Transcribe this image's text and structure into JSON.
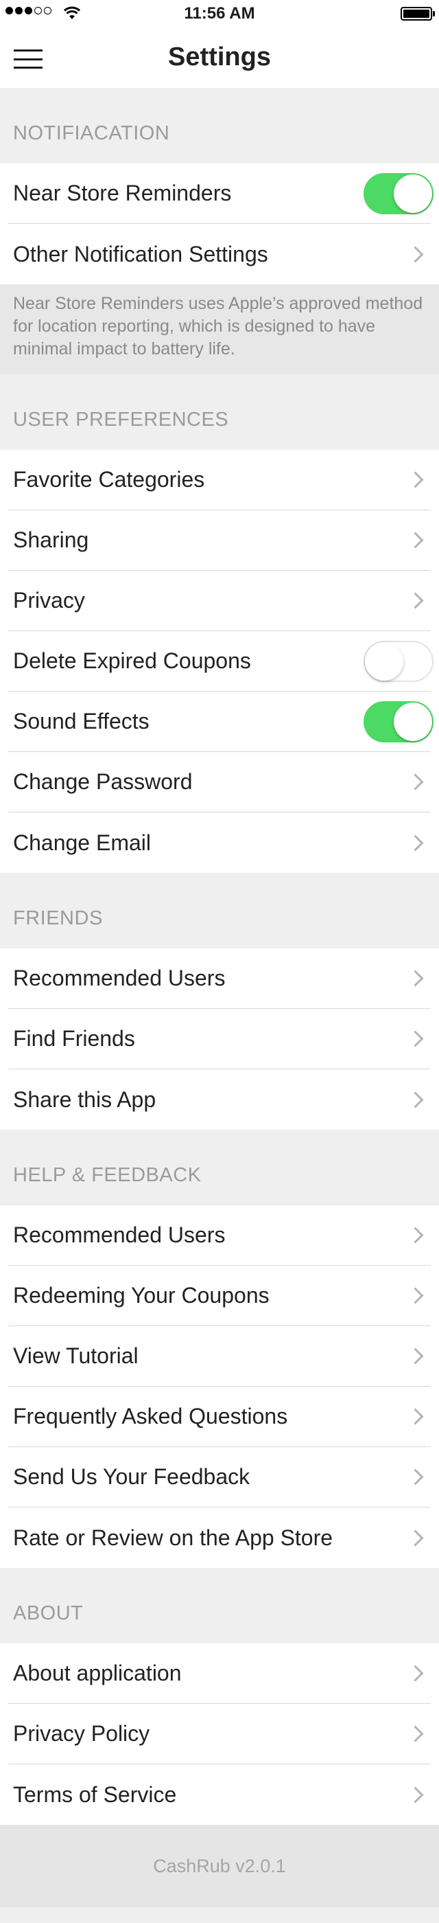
{
  "status_bar": {
    "time": "11:56 AM",
    "signal_bars_filled": 3,
    "signal_bars_total": 5
  },
  "nav": {
    "title": "Settings",
    "menu_icon": "hamburger-menu-icon"
  },
  "colors": {
    "toggle_on": "#4cd964",
    "background": "#efefef"
  },
  "sections": {
    "notification": {
      "header": "NOTIFIACATION",
      "rows": [
        {
          "label": "Near Store Reminders",
          "toggle": true
        },
        {
          "label": "Other Notification Settings"
        }
      ],
      "note": "Near Store Reminders uses Apple’s approved method for location reporting, which is designed to have minimal impact to battery life."
    },
    "user_preferences": {
      "header": "USER PREFERENCES",
      "rows": [
        {
          "label": "Favorite Categories"
        },
        {
          "label": "Sharing"
        },
        {
          "label": "Privacy"
        },
        {
          "label": "Delete Expired Coupons",
          "toggle": false
        },
        {
          "label": "Sound Effects",
          "toggle": true
        },
        {
          "label": "Change Password"
        },
        {
          "label": "Change Email"
        }
      ]
    },
    "friends": {
      "header": "FRIENDS",
      "rows": [
        {
          "label": "Recommended Users"
        },
        {
          "label": "Find Friends"
        },
        {
          "label": "Share this App"
        }
      ]
    },
    "help": {
      "header": "HELP & FEEDBACK",
      "rows": [
        {
          "label": "Recommended Users"
        },
        {
          "label": "Redeeming Your Coupons"
        },
        {
          "label": "View Tutorial"
        },
        {
          "label": "Frequently Asked Questions"
        },
        {
          "label": "Send Us Your Feedback"
        },
        {
          "label": "Rate or Review on the App Store"
        }
      ]
    },
    "about": {
      "header": "ABOUT",
      "rows": [
        {
          "label": "About application"
        },
        {
          "label": "Privacy Policy"
        },
        {
          "label": "Terms of Service"
        }
      ]
    }
  },
  "footer": {
    "version": "CashRub v2.0.1"
  }
}
